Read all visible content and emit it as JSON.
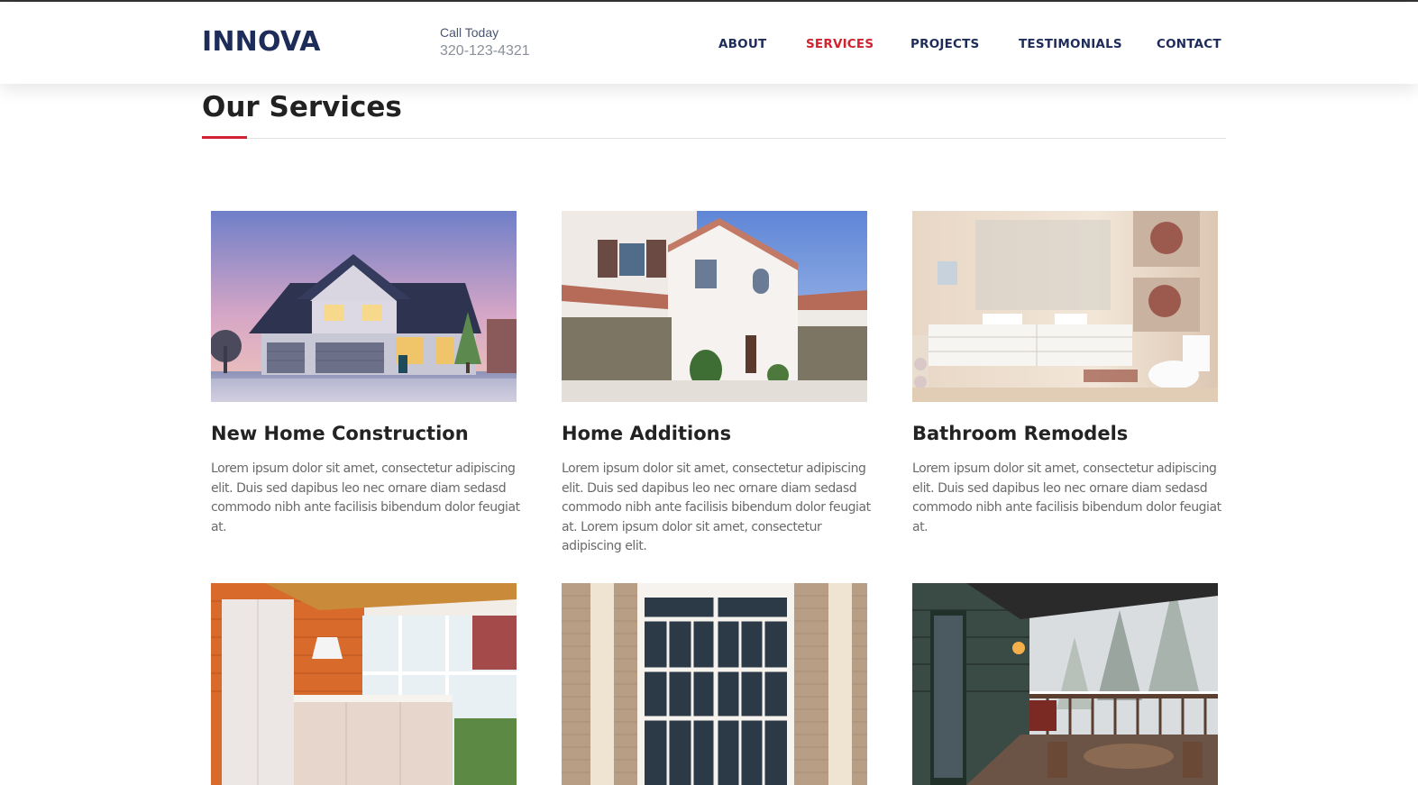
{
  "header": {
    "logo": "INNOVA",
    "call_label": "Call Today",
    "phone": "320-123-4321",
    "nav": [
      {
        "label": "ABOUT",
        "active": false
      },
      {
        "label": "SERVICES",
        "active": true
      },
      {
        "label": "PROJECTS",
        "active": false
      },
      {
        "label": "TESTIMONIALS",
        "active": false
      },
      {
        "label": "CONTACT",
        "active": false
      }
    ]
  },
  "section": {
    "title": "Our Services"
  },
  "services": [
    {
      "title": "New Home Construction",
      "description": "Lorem ipsum dolor sit amet, consectetur adipiscing elit. Duis sed dapibus leo nec ornare diam sedasd commodo nibh ante facilisis bibendum dolor feugiat at.",
      "image": "house-dusk-photo"
    },
    {
      "title": "Home Additions",
      "description": "Lorem ipsum dolor sit amet, consectetur adipiscing elit. Duis sed dapibus leo nec ornare diam sedasd commodo nibh ante facilisis bibendum dolor feugiat at. Lorem ipsum dolor sit amet, consectetur adipiscing elit.",
      "image": "white-stucco-house-photo"
    },
    {
      "title": "Bathroom Remodels",
      "description": "Lorem ipsum dolor sit amet, consectetur adipiscing elit. Duis sed dapibus leo nec ornare diam sedasd commodo nibh ante facilisis bibendum dolor feugiat at.",
      "image": "bathroom-interior-photo"
    },
    {
      "image": "kitchen-interior-photo"
    },
    {
      "image": "window-brick-wall-photo"
    },
    {
      "image": "snowy-deck-photo"
    }
  ],
  "colors": {
    "brand": "#1e2c5a",
    "accent": "#d0232f",
    "text": "#6a6a6a"
  }
}
